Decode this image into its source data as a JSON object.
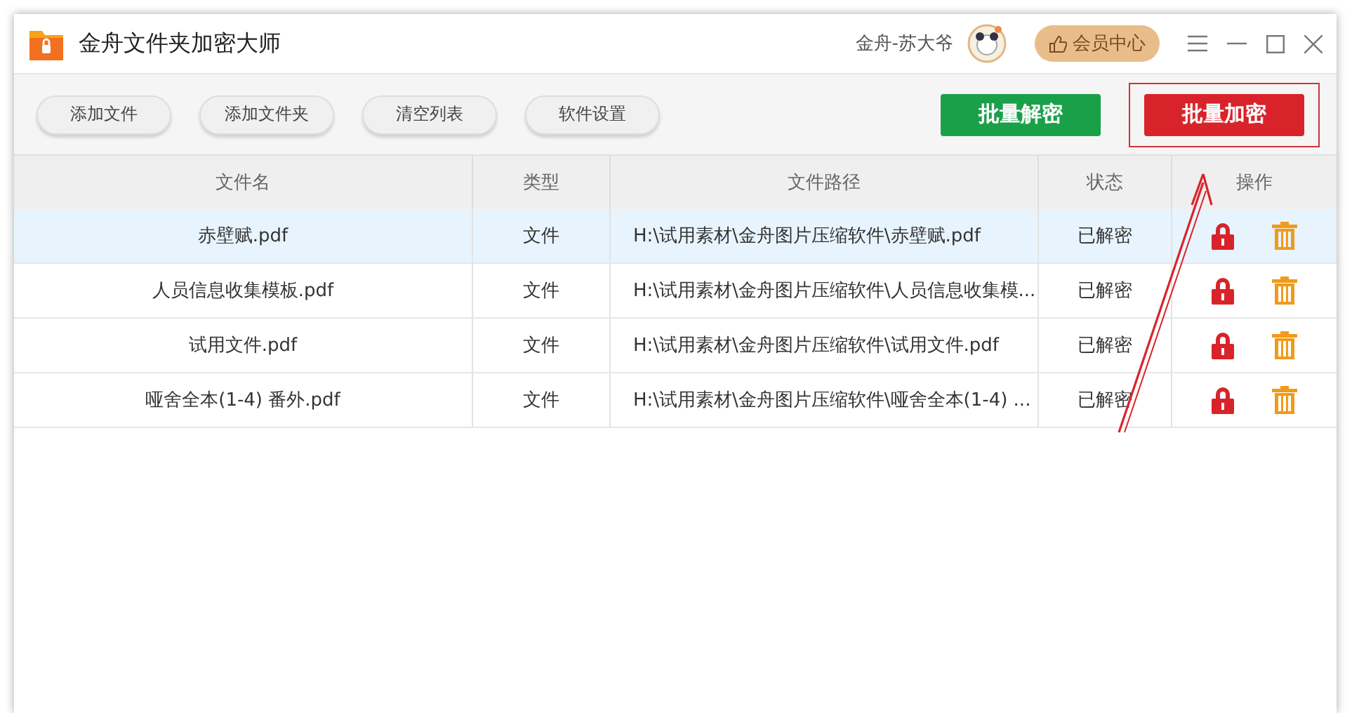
{
  "window": {
    "title": "金舟文件夹加密大师",
    "user": "金舟-苏大爷",
    "member_button": "会员中心"
  },
  "toolbar": {
    "buttons": [
      "添加文件",
      "添加文件夹",
      "清空列表",
      "软件设置"
    ],
    "decrypt_button": "批量解密",
    "encrypt_button": "批量加密"
  },
  "table": {
    "columns": [
      "文件名",
      "类型",
      "文件路径",
      "状态",
      "操作"
    ],
    "rows": [
      {
        "name": "赤壁赋.pdf",
        "type": "文件",
        "path": "H:\\试用素材\\金舟图片压缩软件\\赤壁赋.pdf",
        "status": "已解密",
        "selected": true
      },
      {
        "name": "人员信息收集模板.pdf",
        "type": "文件",
        "path": "H:\\试用素材\\金舟图片压缩软件\\人员信息收集模...",
        "status": "已解密",
        "selected": false
      },
      {
        "name": "试用文件.pdf",
        "type": "文件",
        "path": "H:\\试用素材\\金舟图片压缩软件\\试用文件.pdf",
        "status": "已解密",
        "selected": false
      },
      {
        "name": "哑舍全本(1-4) 番外.pdf",
        "type": "文件",
        "path": "H:\\试用素材\\金舟图片压缩软件\\哑舍全本(1-4) ...",
        "status": "已解密",
        "selected": false
      }
    ]
  }
}
